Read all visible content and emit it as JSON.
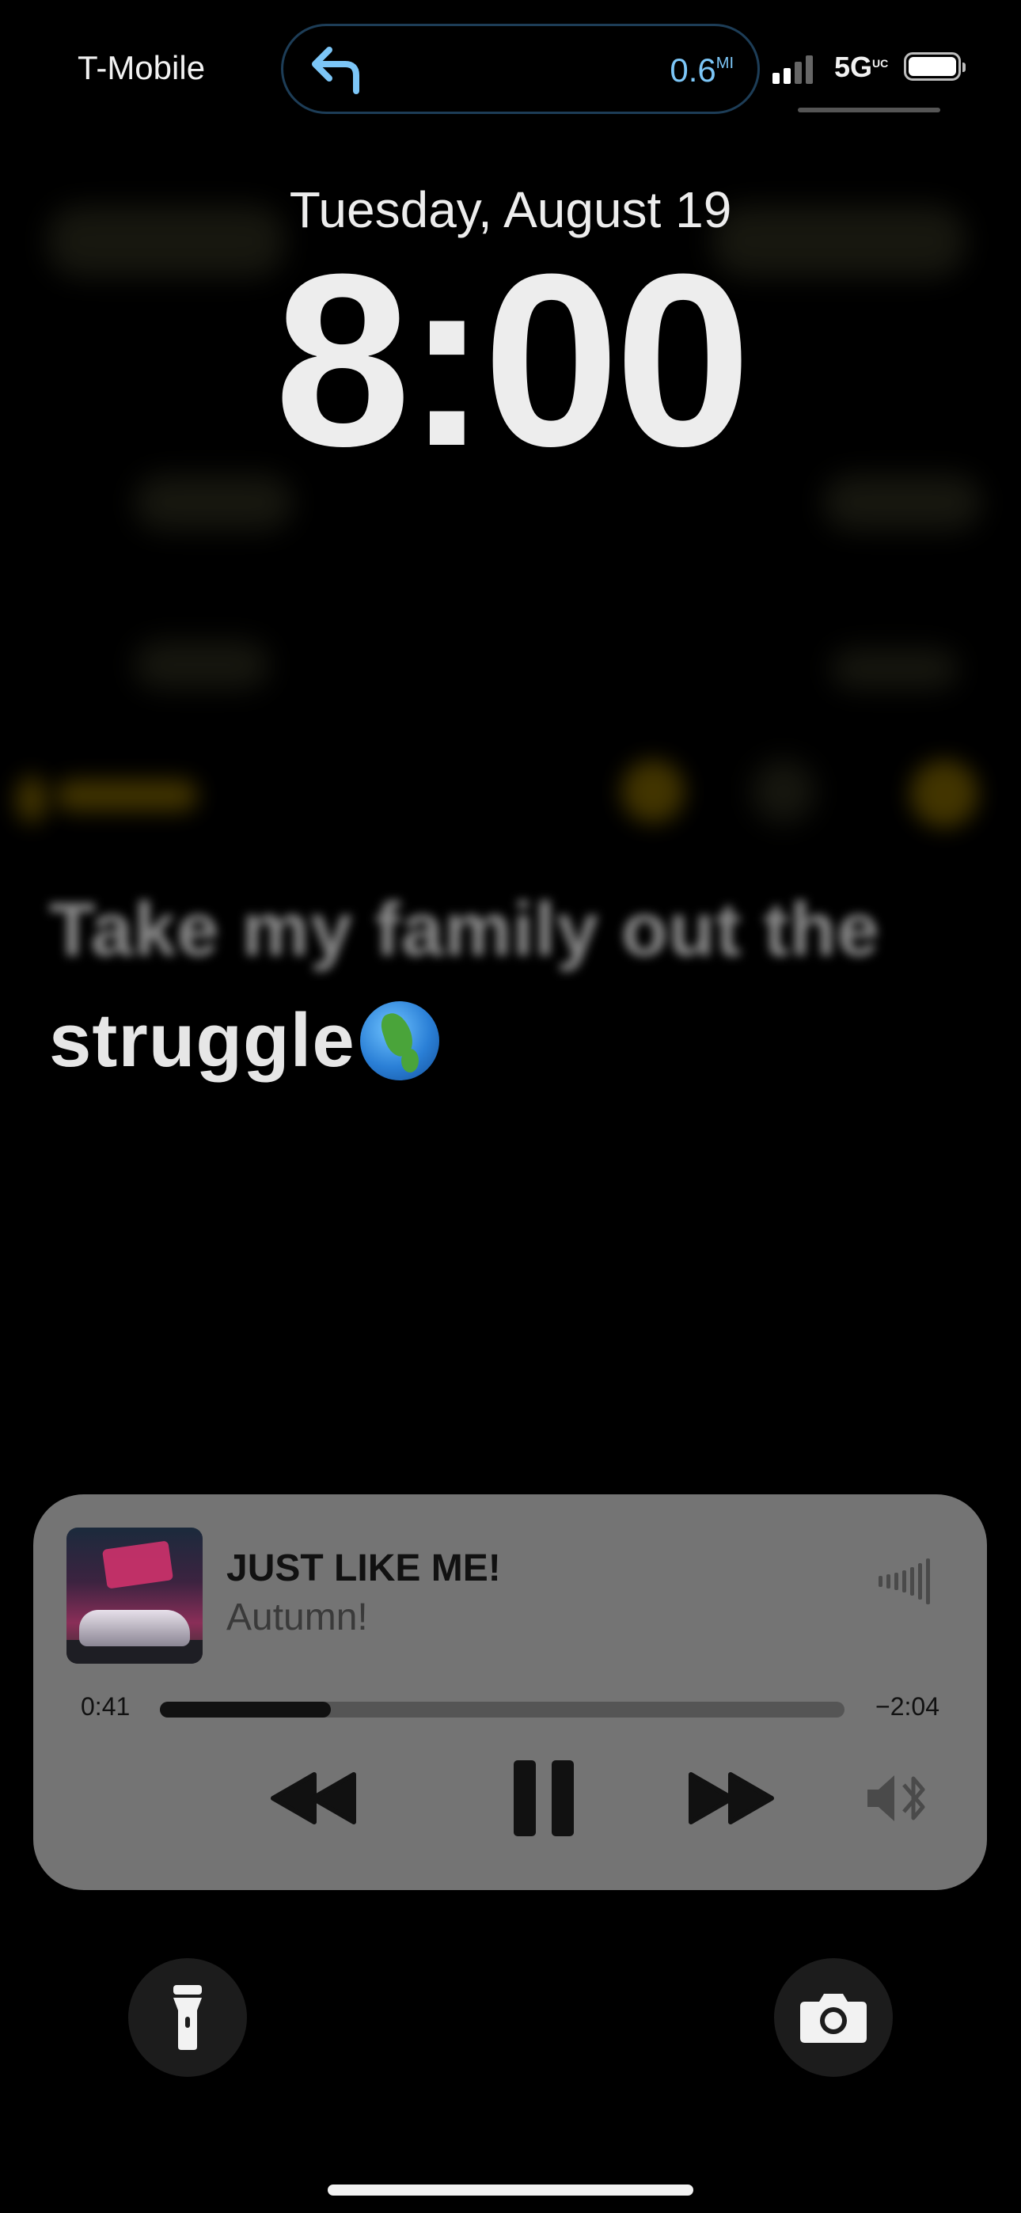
{
  "status_bar": {
    "carrier": "T-Mobile",
    "network": "5G",
    "network_suffix": "UC",
    "signal_bars_active": 2,
    "signal_bars_total": 4,
    "battery_level": 0.95
  },
  "live_activity": {
    "icon": "turn-left-arrow-icon",
    "distance_value": "0.6",
    "distance_unit": "MI",
    "accent_color": "#7cc6f7"
  },
  "lock_screen": {
    "date": "Tuesday, August 19",
    "time": "8:00"
  },
  "background_lyrics": {
    "line_1": "Take my family out the",
    "line_2": "struggle",
    "emoji": "globe-americas-icon"
  },
  "now_playing": {
    "title": "JUST LIKE ME!",
    "artist": "Autumn!",
    "elapsed": "0:41",
    "remaining": "−2:04",
    "progress_fraction": 0.25,
    "controls": {
      "rewind": "rewind-icon",
      "pause": "pause-icon",
      "forward": "fast-forward-icon",
      "output": "bluetooth-speaker-icon"
    },
    "panel_color": "#747474"
  },
  "quick_actions": {
    "left": "flashlight-icon",
    "right": "camera-icon"
  }
}
